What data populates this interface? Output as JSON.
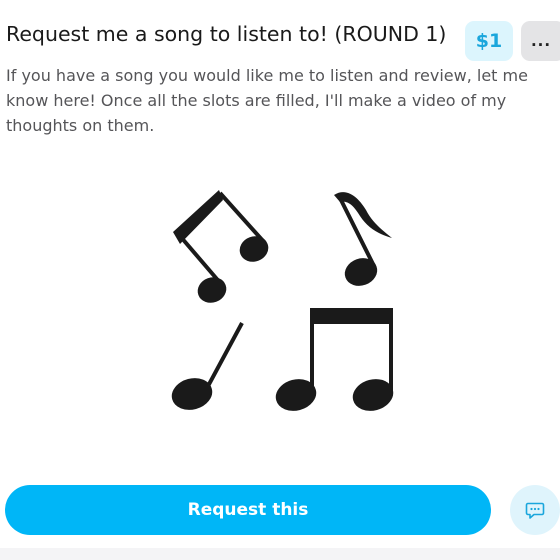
{
  "card": {
    "title": "Request me a song to listen to! (ROUND 1)",
    "price": "$1",
    "more_label": "...",
    "description": "If you have a song you would like me to listen and review, let me know here! Once all the slots are filled, I'll make a video of my thoughts on them.",
    "image_icon": "music-notes-icon",
    "request_label": "Request this",
    "chat_icon": "chat-bubble-icon"
  },
  "colors": {
    "accent": "#00b6f7",
    "price_badge_bg": "#dcf5fd",
    "price_text": "#1aa6dc",
    "more_bg": "#e4e4e6",
    "chat_bg": "#dff4fc"
  }
}
